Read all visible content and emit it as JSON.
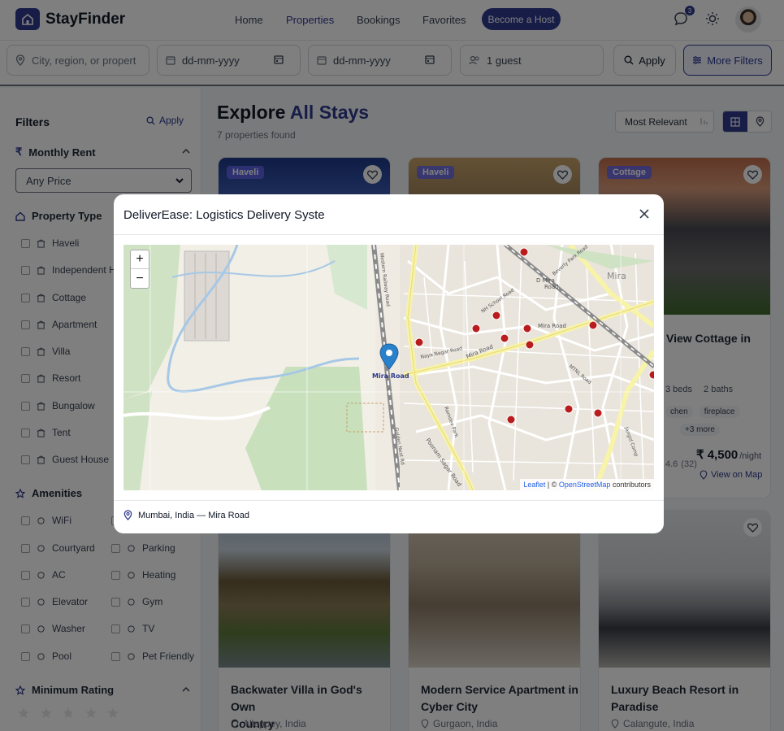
{
  "app": {
    "name": "StayFinder"
  },
  "nav": {
    "home": "Home",
    "properties": "Properties",
    "bookings": "Bookings",
    "favorites": "Favorites",
    "host_button": "Become a Host",
    "notification_count": "3"
  },
  "search": {
    "location_placeholder": "City, region, or propert",
    "checkin_placeholder": "dd-mm-yyyy",
    "checkout_placeholder": "dd-mm-yyyy",
    "guests": "1 guest",
    "apply": "Apply",
    "more_filters": "More Filters"
  },
  "filters": {
    "title": "Filters",
    "apply": "Apply",
    "monthly_rent": {
      "label": "Monthly Rent",
      "selected": "Any Price"
    },
    "property_type": {
      "label": "Property Type",
      "items": [
        "Haveli",
        "Independent House",
        "Cottage",
        "Apartment",
        "Villa",
        "Resort",
        "Bungalow",
        "Tent",
        "Guest House"
      ]
    },
    "amenities": {
      "label": "Amenities",
      "left": [
        "WiFi",
        "Courtyard",
        "AC",
        "Elevator",
        "Washer",
        "Pool"
      ],
      "right": [
        "Kitchen",
        "Parking",
        "Heating",
        "Gym",
        "TV",
        "Pet Friendly"
      ]
    },
    "min_rating": {
      "label": "Minimum Rating",
      "stars": 5
    }
  },
  "main": {
    "title_prefix": "Explore",
    "title_highlight": "All Stays",
    "count": "7 properties found",
    "sort": "Most Relevant"
  },
  "cards": [
    {
      "tag": "Haveli"
    },
    {
      "tag": "Haveli"
    },
    {
      "tag": "Cottage",
      "title_partial": "View Cottage in",
      "beds": "3 beds",
      "baths": "2 baths",
      "amenity_1": "chen",
      "amenity_2": "fireplace",
      "more": "+3 more",
      "rating": "4.6",
      "reviews": "(32)",
      "price": "₹ 4,500",
      "per": "/night",
      "map_link": "View on Map"
    },
    {
      "title_line1": "Backwater Villa in God's Own",
      "title_line2": "Country",
      "location": "Alleppey, India"
    },
    {
      "title_line1": "Modern Service Apartment in",
      "title_line2": "Cyber City",
      "location": "Gurgaon, India"
    },
    {
      "title_line1": "Luxury Beach Resort in",
      "title_line2": "Paradise",
      "location": "Calangute, India"
    }
  ],
  "modal": {
    "title": "DeliverEase: Logistics Delivery Syste",
    "zoom_in": "+",
    "zoom_out": "−",
    "attribution_leaflet": "Leaflet",
    "attribution_sep": "| ©",
    "attribution_osm": "OpenStreetMap",
    "attribution_tail": "contributors",
    "marker_label": "Mira Road",
    "footer_location": "Mumbai, India — Mira Road",
    "map_labels": {
      "mira": "Mira",
      "mira_road_1": "Mira Road",
      "mira_road_2": "Mira Road",
      "d_mira": "D Mira",
      "road": "Road",
      "naya_nagar": "Naya Nagar Road",
      "nh_school": "NH School Road",
      "beverly_park": "Beverly Park Road",
      "poonam_sagar": "Poonam Sagar Road",
      "western_railway": "Western Railway Road",
      "jangid": "Jangid Comp",
      "mtnl": "MTNL Road",
      "ramdev": "Ramdev Park",
      "golden_nest": "Golden Nest Rd"
    }
  },
  "colors": {
    "primary": "#2f3a8f",
    "marker": "#2a81cb",
    "pin": "#b91c1c"
  }
}
